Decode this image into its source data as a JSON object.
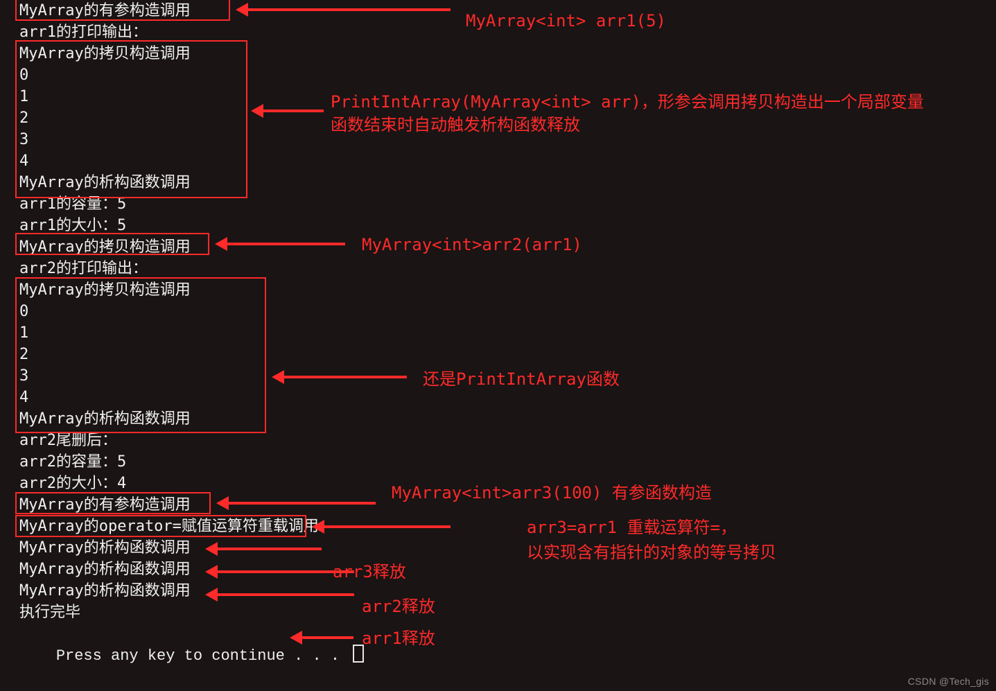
{
  "console": {
    "l0": "MyArray的有参构造调用",
    "l1": "arr1的打印输出：",
    "l2": "MyArray的拷贝构造调用",
    "l3": "0",
    "l4": "1",
    "l5": "2",
    "l6": "3",
    "l7": "4",
    "l8": "MyArray的析构函数调用",
    "l9": "arr1的容量：5",
    "l10": "arr1的大小：5",
    "l11": "MyArray的拷贝构造调用",
    "l12": "arr2的打印输出：",
    "l13": "MyArray的拷贝构造调用",
    "l14": "0",
    "l15": "1",
    "l16": "2",
    "l17": "3",
    "l18": "4",
    "l19": "MyArray的析构函数调用",
    "l20": "arr2尾删后：",
    "l21": "arr2的容量：5",
    "l22": "arr2的大小：4",
    "l23": "MyArray的有参构造调用",
    "l24": "MyArray的operator=赋值运算符重载调用",
    "l25": "MyArray的析构函数调用",
    "l26": "MyArray的析构函数调用",
    "l27": "MyArray的析构函数调用",
    "l28": "执行完毕",
    "l29": "Press any key to continue . . . "
  },
  "annotations": {
    "a1": "MyArray<int> arr1(5)",
    "a2a": "PrintIntArray(MyArray<int> arr)，形参会调用拷贝构造出一个局部变量",
    "a2b": "函数结束时自动触发析构函数释放",
    "a3": "MyArray<int>arr2(arr1)",
    "a4": "还是PrintIntArray函数",
    "a5": "MyArray<int>arr3(100) 有参函数构造",
    "a6a": "arr3=arr1  重载运算符=，",
    "a6b": "以实现含有指针的对象的等号拷贝",
    "a7": "arr3释放",
    "a8": "arr2释放",
    "a9": "arr1释放"
  },
  "watermark": "CSDN @Tech_gis"
}
